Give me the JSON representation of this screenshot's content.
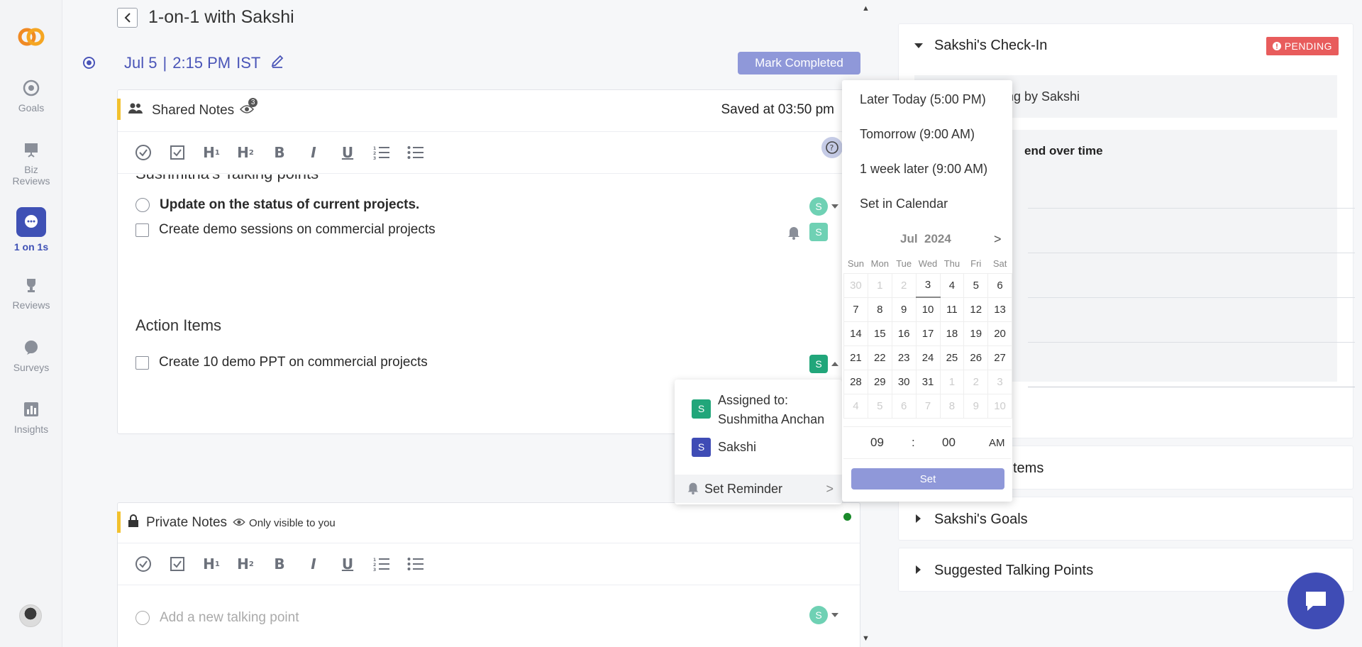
{
  "nav": {
    "items": [
      {
        "label": "Goals"
      },
      {
        "label": "Biz\nReviews"
      },
      {
        "label": "1 on 1s"
      },
      {
        "label": "Reviews"
      },
      {
        "label": "Surveys"
      },
      {
        "label": "Insights"
      }
    ]
  },
  "header": {
    "title": "1-on-1 with Sakshi",
    "date": "Jul 5",
    "sep": "|",
    "time": "2:15 PM",
    "tz": "IST",
    "mark_completed": "Mark Completed"
  },
  "shared_notes": {
    "title": "Shared Notes",
    "viewer_count": "3",
    "saved": "Saved at 03:50 pm",
    "talking_heading": "Sushmitha's Talking points",
    "talking_points": [
      {
        "text": "Update on the status of current projects.",
        "assignee": "S"
      },
      {
        "text": "Create demo sessions on commercial projects",
        "assignee": "S"
      }
    ],
    "action_heading": "Action Items",
    "action_items": [
      {
        "text": "Create 10 demo PPT on commercial projects",
        "assignee": "S"
      }
    ]
  },
  "private_notes": {
    "title": "Private Notes",
    "visibility": "Only visible to you",
    "placeholder": "Add a new talking point",
    "assignee": "S"
  },
  "assign_menu": {
    "assigned_label": "Assigned to:",
    "assigned_name": "Sushmitha Anchan",
    "assigned_initial": "S",
    "other_name": "Sakshi",
    "other_initial": "S",
    "reminder": "Set Reminder",
    "reminder_arrow": ">"
  },
  "picker": {
    "quick": [
      "Later Today (5:00 PM)",
      "Tomorrow (9:00 AM)",
      "1 week later (9:00 AM)",
      "Set in Calendar"
    ],
    "month": "Jul",
    "year": "2024",
    "next": ">",
    "weekdays": [
      "Sun",
      "Mon",
      "Tue",
      "Wed",
      "Thu",
      "Fri",
      "Sat"
    ],
    "weeks": [
      [
        "30",
        "1",
        "2",
        "3",
        "4",
        "5",
        "6"
      ],
      [
        "7",
        "8",
        "9",
        "10",
        "11",
        "12",
        "13"
      ],
      [
        "14",
        "15",
        "16",
        "17",
        "18",
        "19",
        "20"
      ],
      [
        "21",
        "22",
        "23",
        "24",
        "25",
        "26",
        "27"
      ],
      [
        "28",
        "29",
        "30",
        "31",
        "1",
        "2",
        "3"
      ],
      [
        "4",
        "5",
        "6",
        "7",
        "8",
        "9",
        "10"
      ]
    ],
    "hour": "09",
    "colon": ":",
    "minute": "00",
    "ampm": "AM",
    "set": "Set"
  },
  "right": {
    "checkin_title": "Sakshi's Check-In",
    "pending": "PENDING",
    "checkin_status": "ng by Sakshi",
    "trend": "end over time",
    "action_items": "tems",
    "goals": "Sakshi's Goals",
    "suggested": "Suggested Talking Points"
  },
  "colors": {
    "accent": "#3f51b5",
    "button": "#8f98d9",
    "pending": "#e85c5c",
    "badge_green": "#21a67a",
    "badge_blue": "#3f4cb5"
  }
}
